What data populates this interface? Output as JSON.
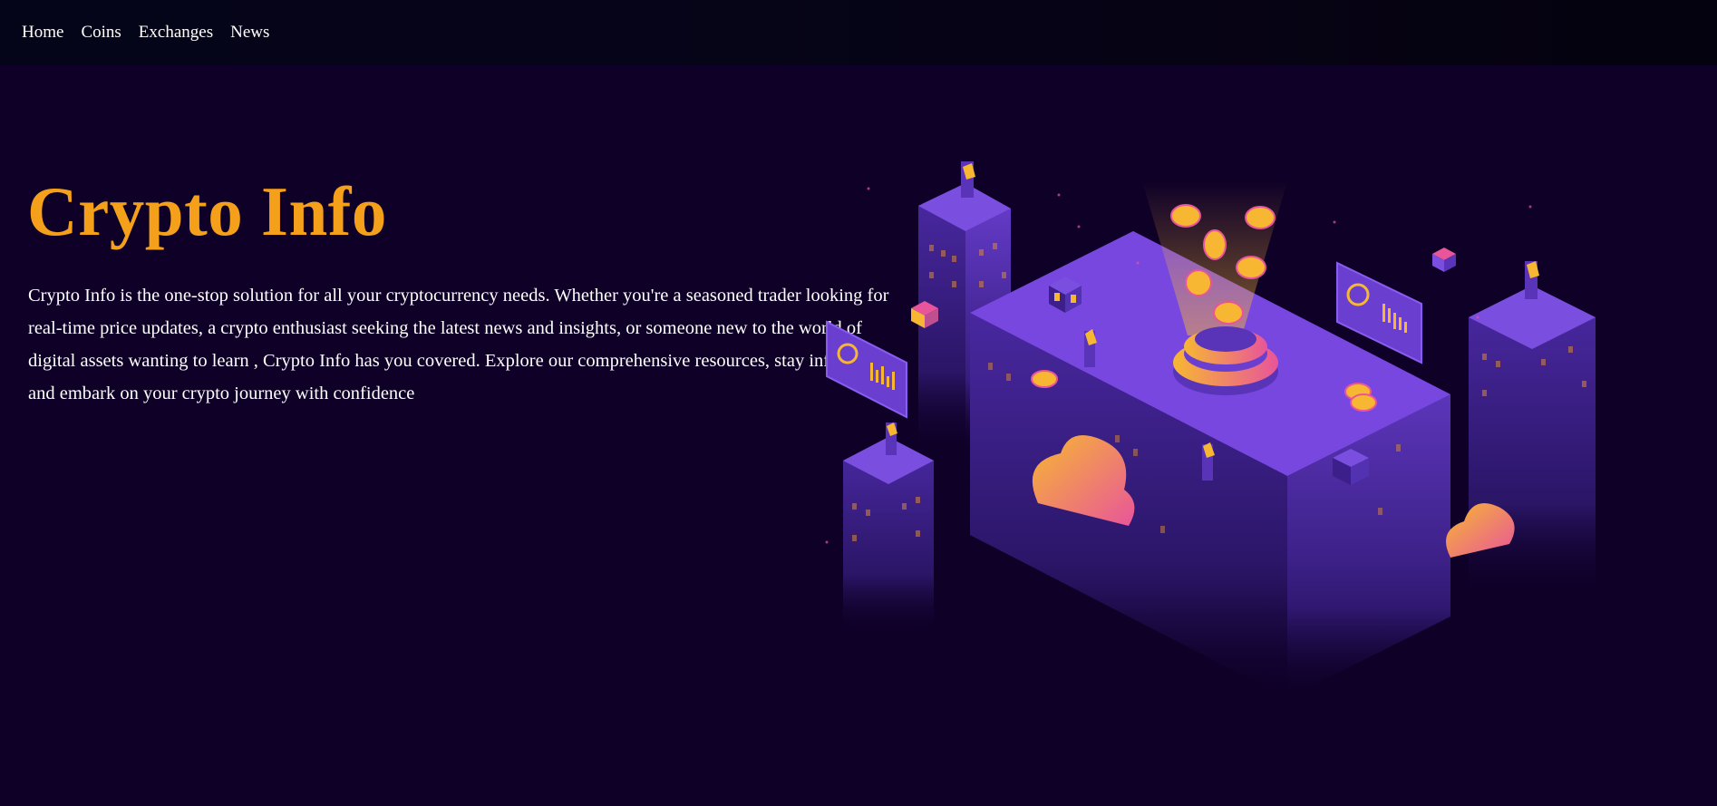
{
  "nav": {
    "items": [
      {
        "label": "Home"
      },
      {
        "label": "Coins"
      },
      {
        "label": "Exchanges"
      },
      {
        "label": "News"
      }
    ]
  },
  "hero": {
    "title": "Crypto Info",
    "description": "Crypto Info is the one-stop solution for all your cryptocurrency needs. Whether you're a seasoned trader looking for real-time price updates, a crypto enthusiast seeking the latest news and insights, or someone new to the world of digital assets wanting to learn , Crypto Info has you covered. Explore our comprehensive resources, stay informed, and embark on your crypto journey with confidence"
  },
  "colors": {
    "background": "#0f0028",
    "navbar": "#05051a",
    "title_accent": "#f5a01a",
    "text": "#ffffff",
    "building_purple": "#6a3fd0",
    "coin_gold": "#f7b733",
    "cloud_pink": "#e8559a"
  },
  "illustration": {
    "icon": "isometric-crypto-city-illustration"
  }
}
